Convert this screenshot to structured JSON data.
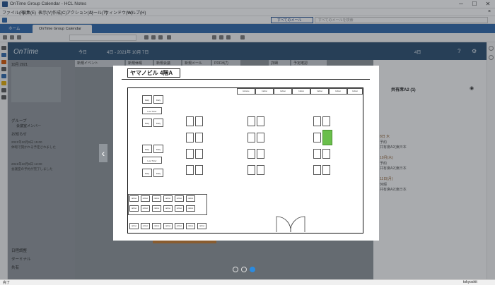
{
  "window": {
    "title": "OnTime Group Calendar - HCL Notes"
  },
  "menubar": {
    "items": [
      "ファイル(F)",
      "編集(E)",
      "表示(V)",
      "作成(C)",
      "アクション(A)",
      "ツール(T)",
      "ウィンドウ(W)",
      "ヘルプ(H)"
    ]
  },
  "search": {
    "scope": "すべてのメール",
    "placeholder": "すべてのメールを検索"
  },
  "tabs": [
    {
      "label": "ホーム"
    },
    {
      "label": "OnTime Group Calendar"
    }
  ],
  "app": {
    "logo": "OnTime",
    "nav": {
      "today": "今日",
      "range": "4日 - 2021年 10月 7日",
      "view": "4日"
    },
    "columns": [
      "新規イベント",
      "新規休暇",
      "新規会議",
      "新規メール",
      "PDF出力"
    ],
    "right_tabs": [
      "詳細",
      "予定確認"
    ],
    "sidebar": {
      "mini_calendar": "10月 2021",
      "group": "グループ",
      "members": "会議室メンバー",
      "notifications": "お知らせ",
      "lower": [
        "日程調整",
        "ターミナル",
        "共有"
      ],
      "feed": [
        {
          "time": "2021年10月9日 15:00",
          "text": "休暇で開かれる予定されました"
        },
        {
          "time": "2021年10月8日 12:00",
          "text": "会議室の予約が完了しました"
        }
      ]
    },
    "right_pane": {
      "title": "共有席A2 (1)",
      "entries": [
        {
          "date": "8日 木",
          "type": "予約",
          "loc": "共有席A2(東日本"
        },
        {
          "date": "10月(木)",
          "type": "予約",
          "loc": "共有席A2(東日本"
        },
        {
          "date": "11日(月)",
          "type": "休暇",
          "loc": "共有席A2(東日本"
        }
      ]
    }
  },
  "modal": {
    "title": "ヤマノビル 4階A",
    "top_lockers": [
      "Entrance",
      "Cabinet",
      "Cabinet",
      "Cabinet",
      "Cabinet",
      "Cabinet",
      "Cabinet"
    ],
    "rooms": [
      "Daily",
      "Daily",
      "Low Tinter",
      "Daily",
      "Daily",
      "Daily",
      "Daily",
      "Low Tinter",
      "Daily",
      "Daily"
    ],
    "bottom_label": "cabinet",
    "selected_desk": "A2",
    "selected_color": "#6abf4b"
  },
  "status": {
    "left": "完了",
    "right": "tokyoshit"
  },
  "colors": {
    "accent": "#2b64a8",
    "header": "#274b6c",
    "selected": "#6abf4b"
  }
}
